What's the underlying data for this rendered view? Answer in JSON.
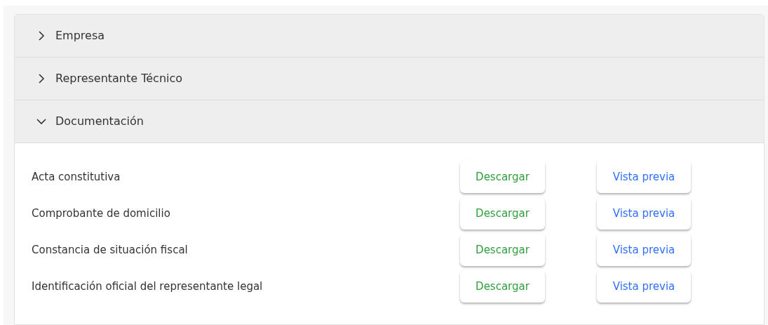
{
  "sections": [
    {
      "title": "Empresa",
      "expanded": false
    },
    {
      "title": "Representante Técnico",
      "expanded": false
    },
    {
      "title": "Documentación",
      "expanded": true,
      "documents": [
        {
          "name": "Acta constitutiva",
          "download": "Descargar",
          "preview": "Vista previa"
        },
        {
          "name": "Comprobante de domicilio",
          "download": "Descargar",
          "preview": "Vista previa"
        },
        {
          "name": "Constancia de situación fiscal",
          "download": "Descargar",
          "preview": "Vista previa"
        },
        {
          "name": "Identificación oficial del representante legal",
          "download": "Descargar",
          "preview": "Vista previa"
        }
      ]
    }
  ]
}
